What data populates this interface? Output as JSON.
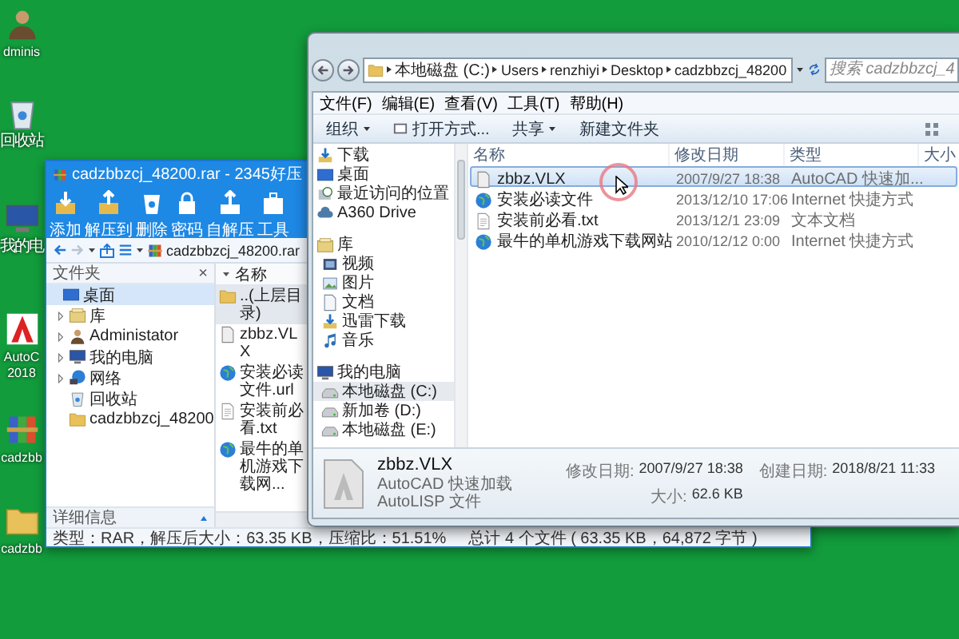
{
  "desktop_icons": [
    {
      "kind": "user",
      "label": "dminis"
    },
    {
      "kind": "recycle",
      "label": "回收站"
    },
    {
      "kind": "computer",
      "label": "我的电"
    },
    {
      "kind": "autocad",
      "label": "AutoC 2018"
    },
    {
      "kind": "archive",
      "label": "cadzbb"
    },
    {
      "kind": "folder",
      "label": "cadzbb"
    }
  ],
  "archive_window": {
    "title": "cadzbbzcj_48200.rar - 2345好压",
    "toolbar": [
      {
        "kind": "add",
        "label": "添加"
      },
      {
        "kind": "extract",
        "label": "解压到"
      },
      {
        "kind": "delete",
        "label": "删除"
      },
      {
        "kind": "lock",
        "label": "密码"
      },
      {
        "kind": "selfextract",
        "label": "自解压"
      },
      {
        "kind": "tools",
        "label": "工具"
      }
    ],
    "address": "cadzbbzcj_48200.rar",
    "folder_pane": {
      "title": "文件夹",
      "close": "×",
      "tree": [
        {
          "label": "桌面",
          "kind": "desktop",
          "selected": true,
          "expandable": false,
          "children": [
            {
              "label": "库",
              "kind": "library",
              "selected": false,
              "expandable": true
            },
            {
              "label": "Administator",
              "kind": "user",
              "selected": false,
              "expandable": true
            },
            {
              "label": "我的电脑",
              "kind": "computer",
              "selected": false,
              "expandable": true
            },
            {
              "label": "网络",
              "kind": "network",
              "selected": false,
              "expandable": true
            },
            {
              "label": "回收站",
              "kind": "recycle",
              "selected": false,
              "expandable": false
            },
            {
              "label": "cadzbbzcj_48200",
              "kind": "folder",
              "selected": false,
              "expandable": false
            }
          ]
        }
      ]
    },
    "list_header": "名称",
    "files": [
      {
        "name": "..(上层目录)",
        "kind": "folder",
        "selected": true
      },
      {
        "name": "zbbz.VLX",
        "kind": "vlx",
        "selected": false
      },
      {
        "name": "安装必读文件.url",
        "kind": "url",
        "selected": false
      },
      {
        "name": "安装前必看.txt",
        "kind": "txt",
        "selected": false
      },
      {
        "name": "最牛的单机游戏下载网...",
        "kind": "url",
        "selected": false
      }
    ],
    "details_toggle": "详细信息",
    "status_left": "类型：RAR，解压后大小：63.35 KB，压缩比：51.51%",
    "status_right": "总计 4 个文件 ( 63.35 KB，64,872 字节 )"
  },
  "explorer_window": {
    "path": [
      "本地磁盘 (C:)",
      "Users",
      "renzhiyi",
      "Desktop",
      "cadzbbzcj_48200"
    ],
    "search": {
      "placeholder": "搜索 cadzbbzcj_4"
    },
    "menu": [
      "文件(F)",
      "编辑(E)",
      "查看(V)",
      "工具(T)",
      "帮助(H)"
    ],
    "toolbar": [
      {
        "label": "组织",
        "kind": "menu"
      },
      {
        "label": "打开方式...",
        "kind": "open"
      },
      {
        "label": "共享",
        "kind": "menu"
      },
      {
        "label": "新建文件夹",
        "kind": "plain"
      }
    ],
    "nav": [
      {
        "label": "下载",
        "kind": "download",
        "selected": false
      },
      {
        "label": "桌面",
        "kind": "desktop",
        "selected": false
      },
      {
        "label": "最近访问的位置",
        "kind": "recent",
        "selected": false
      },
      {
        "label": "A360 Drive",
        "kind": "cloud",
        "selected": false
      },
      {
        "label": "库",
        "kind": "library",
        "selected": false,
        "children": [
          {
            "label": "视频",
            "kind": "video",
            "selected": false
          },
          {
            "label": "图片",
            "kind": "picture",
            "selected": false
          },
          {
            "label": "文档",
            "kind": "doc",
            "selected": false
          },
          {
            "label": "迅雷下载",
            "kind": "download",
            "selected": false
          },
          {
            "label": "音乐",
            "kind": "music",
            "selected": false
          }
        ]
      },
      {
        "label": "我的电脑",
        "kind": "computer",
        "selected": false,
        "children": [
          {
            "label": "本地磁盘 (C:)",
            "kind": "drive",
            "selected": true
          },
          {
            "label": "新加卷 (D:)",
            "kind": "drive",
            "selected": false
          },
          {
            "label": "本地磁盘 (E:)",
            "kind": "drive",
            "selected": false
          }
        ]
      }
    ],
    "columns": [
      "名称",
      "修改日期",
      "类型",
      "大小"
    ],
    "rows": [
      {
        "name": "zbbz.VLX",
        "kind": "vlx",
        "modified": "2007/9/27 18:38",
        "type": "AutoCAD 快速加...",
        "selected": true
      },
      {
        "name": "安装必读文件",
        "kind": "url",
        "modified": "2013/12/10 17:06",
        "type": "Internet 快捷方式",
        "selected": false
      },
      {
        "name": "安装前必看.txt",
        "kind": "txt",
        "modified": "2013/12/1 23:09",
        "type": "文本文档",
        "selected": false
      },
      {
        "name": "最牛的单机游戏下载网站",
        "kind": "url",
        "modified": "2010/12/12 0:00",
        "type": "Internet 快捷方式",
        "selected": false
      }
    ],
    "details": {
      "name": "zbbz.VLX",
      "kind": "vlx",
      "description": "AutoCAD 快速加载 AutoLISP 文件",
      "fields": [
        {
          "label": "修改日期:",
          "value": "2007/9/27 18:38"
        },
        {
          "label": "大小:",
          "value": "62.6 KB"
        },
        {
          "label": "创建日期:",
          "value": "2018/8/21 11:33"
        }
      ]
    }
  }
}
